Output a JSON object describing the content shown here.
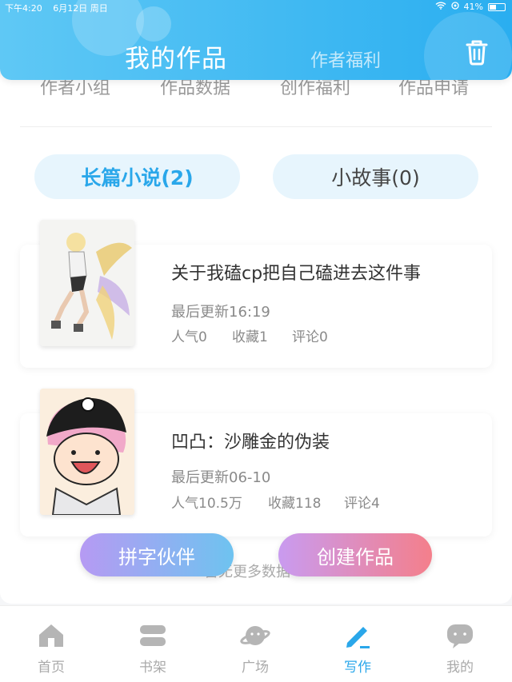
{
  "status": {
    "time": "下午4:20",
    "date": "6月12日 周日",
    "battery": "41%"
  },
  "header": {
    "title": "我的作品",
    "subtitle": "作者福利"
  },
  "subnav": [
    "作者小组",
    "作品数据",
    "创作福利",
    "作品申请"
  ],
  "tabs": {
    "long": "长篇小说(2)",
    "short": "小故事(0)"
  },
  "works": [
    {
      "title": "关于我磕cp把自己磕进去这件事",
      "updated": "最后更新16:19",
      "popularity": "人气0",
      "favorites": "收藏1",
      "comments": "评论0"
    },
    {
      "title": "凹凸：沙雕金的伪装",
      "updated": "最后更新06-10",
      "popularity": "人气10.5万",
      "favorites": "收藏118",
      "comments": "评论4"
    }
  ],
  "no_more": "暂无更多数据",
  "buttons": {
    "partner": "拼字伙伴",
    "create": "创建作品"
  },
  "nav": [
    {
      "label": "首页",
      "icon": "home-icon"
    },
    {
      "label": "书架",
      "icon": "bookshelf-icon"
    },
    {
      "label": "广场",
      "icon": "planet-icon"
    },
    {
      "label": "写作",
      "icon": "pen-icon",
      "active": true
    },
    {
      "label": "我的",
      "icon": "chat-bubble-icon"
    }
  ],
  "colors": {
    "accent": "#2aa7ea",
    "header": "#2aaef0"
  }
}
